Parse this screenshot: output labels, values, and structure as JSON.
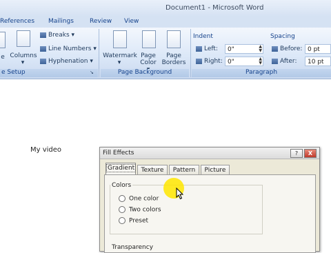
{
  "window": {
    "title": "Document1 - Microsoft Word"
  },
  "tabs": [
    "References",
    "Mailings",
    "Review",
    "View"
  ],
  "ribbon": {
    "page_setup": {
      "label": "e Setup",
      "columns": "Columns",
      "left_partial": "e",
      "breaks": "Breaks",
      "line_numbers": "Line Numbers",
      "hyphenation": "Hyphenation"
    },
    "page_background": {
      "label": "Page Background",
      "watermark": "Watermark",
      "page_color_line1": "Page",
      "page_color_line2": "Color",
      "page_borders_line1": "Page",
      "page_borders_line2": "Borders"
    },
    "paragraph": {
      "label": "Paragraph",
      "indent_heading": "Indent",
      "indent_left_label": "Left:",
      "indent_left_value": "0\"",
      "indent_right_label": "Right:",
      "indent_right_value": "0\"",
      "spacing_heading": "Spacing",
      "spacing_before_label": "Before:",
      "spacing_before_value": "0 pt",
      "spacing_after_label": "After:",
      "spacing_after_value": "10 pt"
    }
  },
  "document": {
    "text": "My video"
  },
  "dialog": {
    "title": "Fill Effects",
    "help_button": "?",
    "close_button": "X",
    "tabs": [
      "Gradient",
      "Texture",
      "Pattern",
      "Picture"
    ],
    "colors_label": "Colors",
    "options": [
      "One color",
      "Two colors",
      "Preset"
    ],
    "transparency_label": "Transparency"
  },
  "colors": {
    "ribbon_text": "#15428b",
    "highlight": "#ffe600"
  }
}
